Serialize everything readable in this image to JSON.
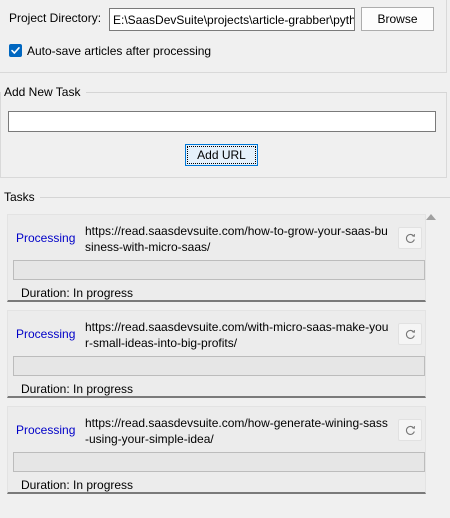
{
  "project": {
    "label": "Project Directory:",
    "path_value": "E:\\SaasDevSuite\\projects\\article-grabber\\pyth",
    "browse_label": "Browse"
  },
  "autosave": {
    "label": "Auto-save articles after processing",
    "checked": true
  },
  "add_task": {
    "title": "Add New Task",
    "url_value": "",
    "add_label": "Add URL"
  },
  "tasks": {
    "title": "Tasks",
    "items": [
      {
        "status": "Processing",
        "url": "https://read.saasdevsuite.com/how-to-grow-your-saas-business-with-micro-saas/",
        "progress": 0,
        "duration": "Duration: In progress"
      },
      {
        "status": "Processing",
        "url": "https://read.saasdevsuite.com/with-micro-saas-make-your-small-ideas-into-big-profits/",
        "progress": 0,
        "duration": "Duration: In progress"
      },
      {
        "status": "Processing",
        "url": "https://read.saasdevsuite.com/how-generate-wining-sass-using-your-simple-idea/",
        "progress": 0,
        "duration": "Duration: In progress"
      }
    ]
  },
  "colors": {
    "status_processing": "#0000c8",
    "checkbox_accent": "#0067c0",
    "focus_border": "#0078d7"
  },
  "icons": {
    "refresh": "refresh-icon",
    "check": "check-icon",
    "scroll_up": "arrow-up-icon"
  }
}
